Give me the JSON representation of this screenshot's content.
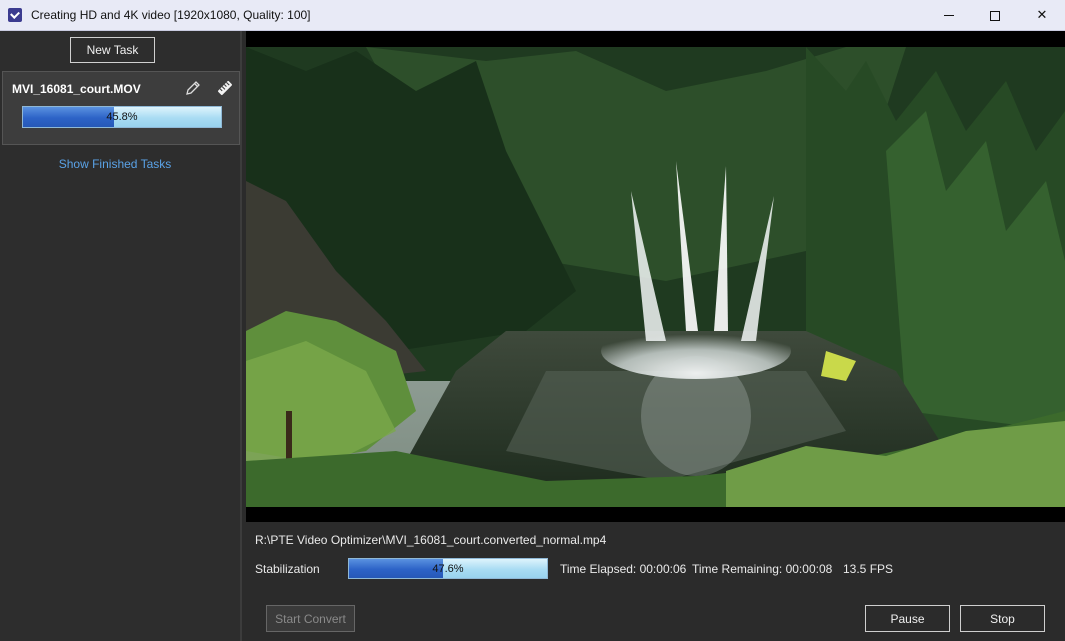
{
  "window": {
    "title": "Creating HD and 4K video [1920x1080, Quality: 100]"
  },
  "sidebar": {
    "new_task_label": "New Task",
    "task": {
      "name": "MVI_16081_court.MOV",
      "progress_text": "45.8%",
      "progress_value": 0.458,
      "edit_icon": "pencil-icon",
      "ruler_icon": "ruler-icon"
    },
    "show_finished_label": "Show Finished Tasks"
  },
  "main": {
    "output_path": "R:\\PTE Video Optimizer\\MVI_16081_court.converted_normal.mp4",
    "stage_label": "Stabilization",
    "progress_text": "47.6%",
    "progress_value": 0.476,
    "time_elapsed": "Time Elapsed: 00:00:06",
    "time_remaining": "Time Remaining: 00:00:08",
    "fps": "13.5 FPS"
  },
  "buttons": {
    "start_convert": "Start Convert",
    "pause": "Pause",
    "stop": "Stop"
  },
  "colors": {
    "progress_dark": "#2d63c7",
    "progress_light": "#bfe6f7",
    "link": "#5aa2e6"
  }
}
